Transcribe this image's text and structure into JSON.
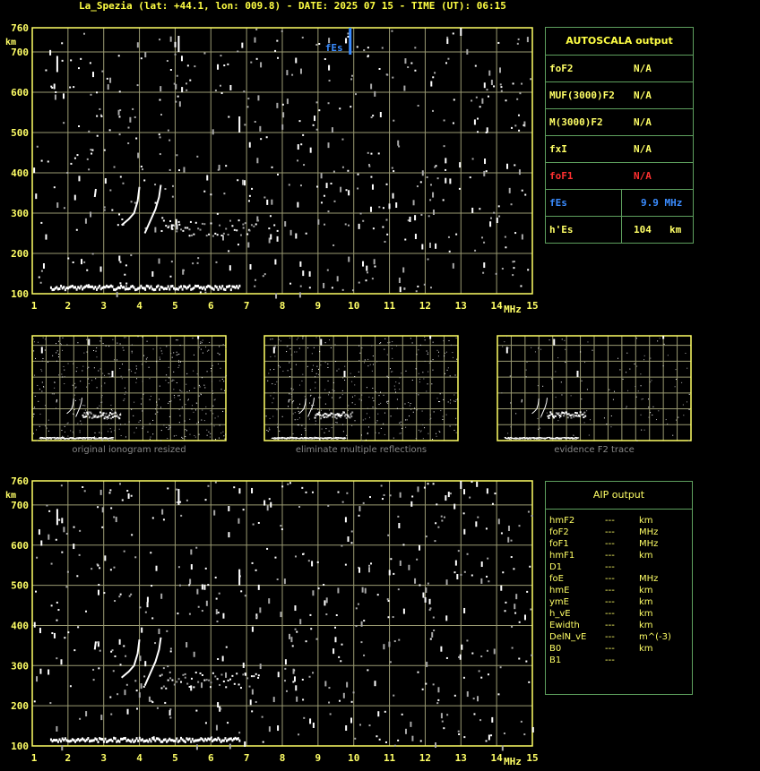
{
  "header": {
    "title": "La_Spezia (lat: +44.1, lon: 009.8) - DATE: 2025 07 15 - TIME (UT): 06:15"
  },
  "colors": {
    "grid": "#9a9a72",
    "axis": "#ffff66",
    "trace": "#ffffff",
    "panel_border": "#5ea05e",
    "fof1": "#ff3030",
    "fes": "#3a8cff"
  },
  "ionogram": {
    "y_unit": "km",
    "x_unit": "MHz",
    "y_ticks": [
      "100",
      "200",
      "300",
      "400",
      "500",
      "600",
      "700",
      "760"
    ],
    "x_ticks": [
      "1",
      "2",
      "3",
      "4",
      "5",
      "6",
      "7",
      "8",
      "9",
      "10",
      "11",
      "12",
      "13",
      "14",
      "15"
    ],
    "fes_marker_label": "fEs",
    "fes_marker_mhz": 9.9
  },
  "autoscala": {
    "title": "AUTOSCALA output",
    "rows": [
      {
        "param": "foF2",
        "value": "N/A"
      },
      {
        "param": "MUF(3000)F2",
        "value": "N/A"
      },
      {
        "param": "M(3000)F2",
        "value": "N/A"
      },
      {
        "param": "fxI",
        "value": "N/A"
      },
      {
        "param": "foF1",
        "value": "N/A"
      },
      {
        "param": "fEs",
        "value": "9.9 MHz"
      },
      {
        "param": "h'Es",
        "value": "104",
        "unit": "km"
      }
    ]
  },
  "thumbnails": [
    {
      "caption": "original ionogram resized"
    },
    {
      "caption": "eliminate multiple reflections"
    },
    {
      "caption": "evidence F2 trace"
    }
  ],
  "aip": {
    "title": "AIP output",
    "rows": [
      {
        "param": "hmF2",
        "dash": "---",
        "unit": "km"
      },
      {
        "param": "foF2",
        "dash": "---",
        "unit": "MHz"
      },
      {
        "param": "foF1",
        "dash": "---",
        "unit": "MHz"
      },
      {
        "param": "hmF1",
        "dash": "---",
        "unit": "km"
      },
      {
        "param": "D1",
        "dash": "---",
        "unit": ""
      },
      {
        "param": "foE",
        "dash": "---",
        "unit": "MHz"
      },
      {
        "param": "hmE",
        "dash": "---",
        "unit": "km"
      },
      {
        "param": "ymE",
        "dash": "---",
        "unit": "km"
      },
      {
        "param": "h_vE",
        "dash": "---",
        "unit": "km"
      },
      {
        "param": "Ewidth",
        "dash": "---",
        "unit": "km"
      },
      {
        "param": "DelN_vE",
        "dash": "---",
        "unit": "m^(-3)"
      },
      {
        "param": "B0",
        "dash": "---",
        "unit": "km"
      },
      {
        "param": "B1",
        "dash": "---",
        "unit": ""
      }
    ]
  }
}
